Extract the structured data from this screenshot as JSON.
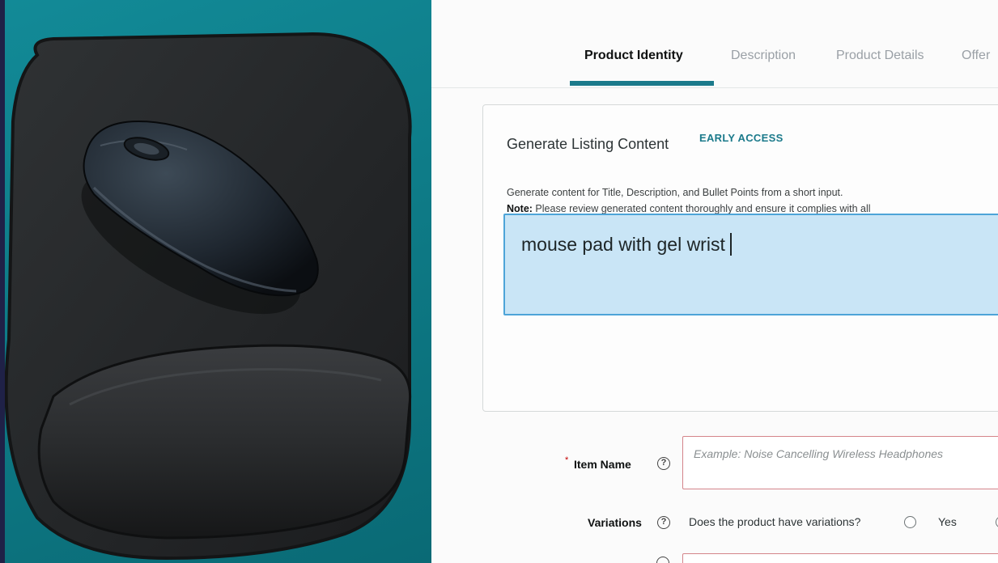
{
  "tabs": [
    {
      "label": "Product Identity",
      "active": true
    },
    {
      "label": "Description",
      "active": false
    },
    {
      "label": "Product Details",
      "active": false
    },
    {
      "label": "Offer",
      "active": false
    }
  ],
  "generate": {
    "title": "Generate Listing Content",
    "badge": "EARLY ACCESS",
    "description": "Generate content for Title, Description, and Bullet Points from a short input.",
    "note_label": "Note:",
    "note_text": " Please review generated content thoroughly and ensure it complies with all",
    "input_value": "mouse pad with gel wrist"
  },
  "item_name": {
    "required_mark": "*",
    "label": "Item Name",
    "help_glyph": "?",
    "placeholder": "Example: Noise Cancelling Wireless Headphones"
  },
  "variations": {
    "label": "Variations",
    "help_glyph": "?",
    "question": "Does the product have variations?",
    "option_yes": "Yes"
  },
  "colors": {
    "accent": "#1b7a8b",
    "input_highlight": "#c9e5f6",
    "input_border_active": "#4da4d8",
    "input_border_error": "#d4848a",
    "photo_background": "#0e7c88"
  }
}
